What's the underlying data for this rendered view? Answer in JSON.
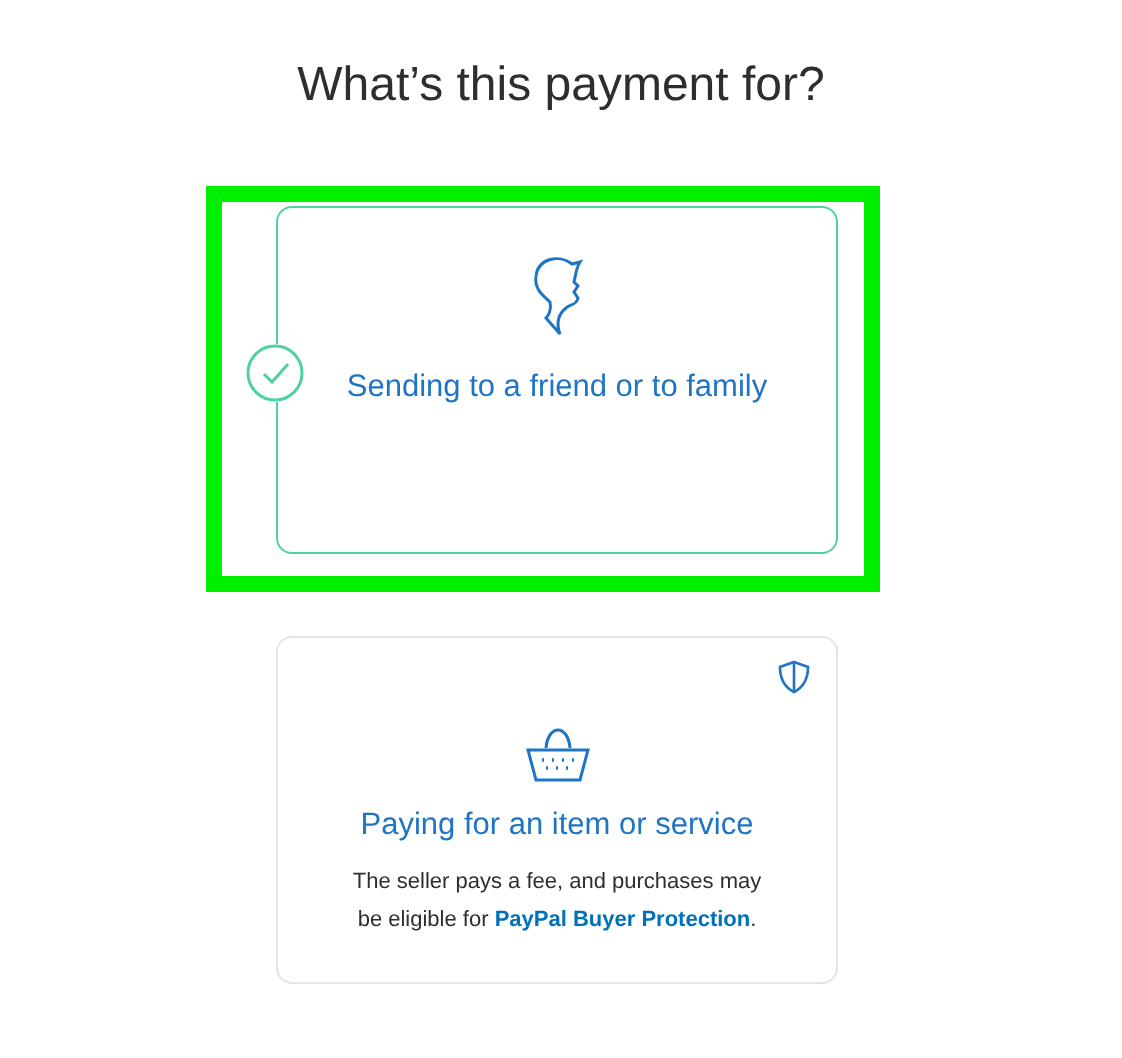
{
  "heading": "What’s this payment for?",
  "options": [
    {
      "kind": "person",
      "label": "Sending to a friend or to family",
      "selected": true,
      "highlighted": true,
      "shield": false
    },
    {
      "kind": "basket",
      "label": "Paying for an item or service",
      "selected": false,
      "highlighted": false,
      "shield": true,
      "description": "The seller pays a fee, and purchases may be eligible for",
      "link": "PayPal Buyer Protection",
      "description_end": "."
    }
  ]
}
